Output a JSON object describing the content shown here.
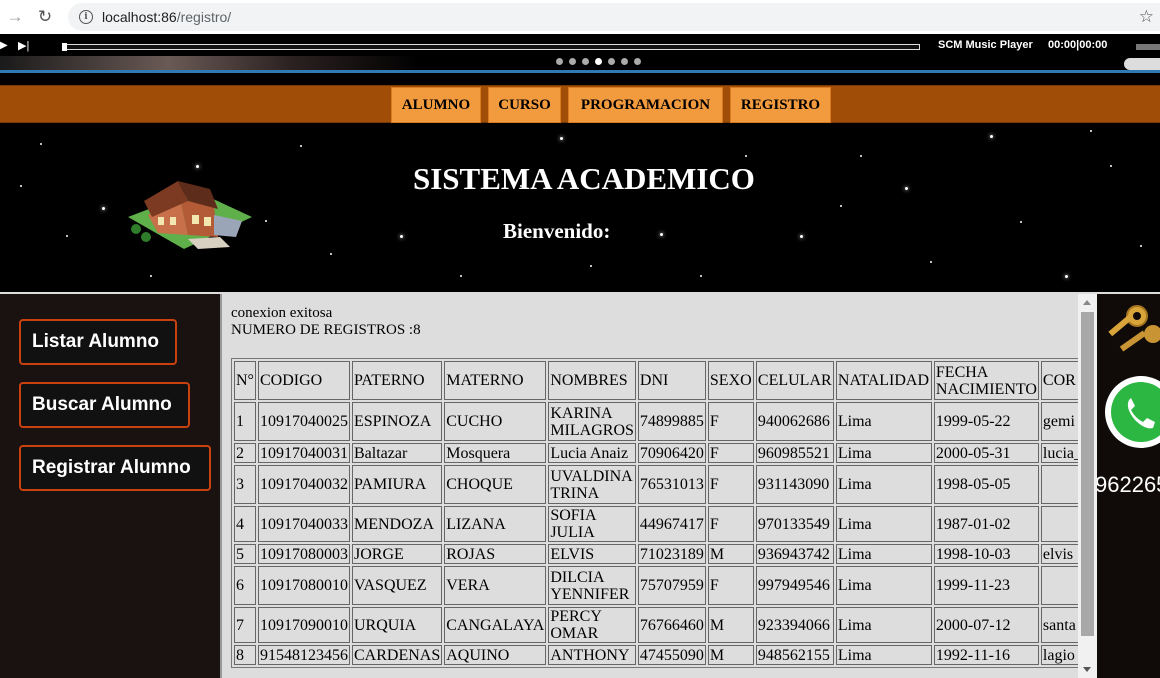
{
  "browser": {
    "url_host": "localhost:86",
    "url_path": "/registro/"
  },
  "player": {
    "title": "SCM Music Player",
    "time": "00:00|00:00"
  },
  "menu": {
    "items": [
      {
        "label": "ALUMNO"
      },
      {
        "label": "CURSO"
      },
      {
        "label": "PROGRAMACION"
      },
      {
        "label": "REGISTRO"
      }
    ]
  },
  "banner": {
    "title": "SISTEMA ACADEMICO",
    "welcome": "Bienvenido:"
  },
  "sidebar": {
    "items": [
      {
        "label": "Listar Alumno"
      },
      {
        "label": "Buscar Alumno"
      },
      {
        "label": "Registrar Alumno"
      }
    ]
  },
  "main": {
    "status": "conexion exitosa",
    "count_text": "NUMERO DE REGISTROS :8",
    "table": {
      "headers": [
        "N°",
        "CODIGO",
        "PATERNO",
        "MATERNO",
        "NOMBRES",
        "DNI",
        "SEXO",
        "CELULAR",
        "NATALIDAD",
        "FECHA NACIMIENTO",
        "COR"
      ],
      "rows": [
        [
          "1",
          "10917040025",
          "ESPINOZA",
          "CUCHO",
          "KARINA MILAGROS",
          "74899885",
          "F",
          "940062686",
          "Lima",
          "1999-05-22",
          "gemi"
        ],
        [
          "2",
          "10917040031",
          "Baltazar",
          "Mosquera",
          "Lucia Anaiz",
          "70906420",
          "F",
          "960985521",
          "Lima",
          "2000-05-31",
          "lucia_"
        ],
        [
          "3",
          "10917040032",
          "PAMIURA",
          "CHOQUE",
          "UVALDINA TRINA",
          "76531013",
          "F",
          "931143090",
          "Lima",
          "1998-05-05",
          ""
        ],
        [
          "4",
          "10917040033",
          "MENDOZA",
          "LIZANA",
          "SOFIA JULIA",
          "44967417",
          "F",
          "970133549",
          "Lima",
          "1987-01-02",
          ""
        ],
        [
          "5",
          "10917080003",
          "JORGE",
          "ROJAS",
          "ELVIS",
          "71023189",
          "M",
          "936943742",
          "Lima",
          "1998-10-03",
          "elvis"
        ],
        [
          "6",
          "10917080010",
          "VASQUEZ",
          "VERA",
          "DILCIA YENNIFER",
          "75707959",
          "F",
          "997949546",
          "Lima",
          "1999-11-23",
          ""
        ],
        [
          "7",
          "10917090010",
          "URQUIA",
          "CANGALAYA",
          "PERCY OMAR",
          "76766460",
          "M",
          "923394066",
          "Lima",
          "2000-07-12",
          "santa"
        ],
        [
          "8",
          "91548123456",
          "CARDENAS",
          "AQUINO",
          "ANTHONY",
          "47455090",
          "M",
          "948562155",
          "Lima",
          "1992-11-16",
          "lagio"
        ]
      ]
    }
  },
  "right_panel": {
    "phone": "962265"
  }
}
